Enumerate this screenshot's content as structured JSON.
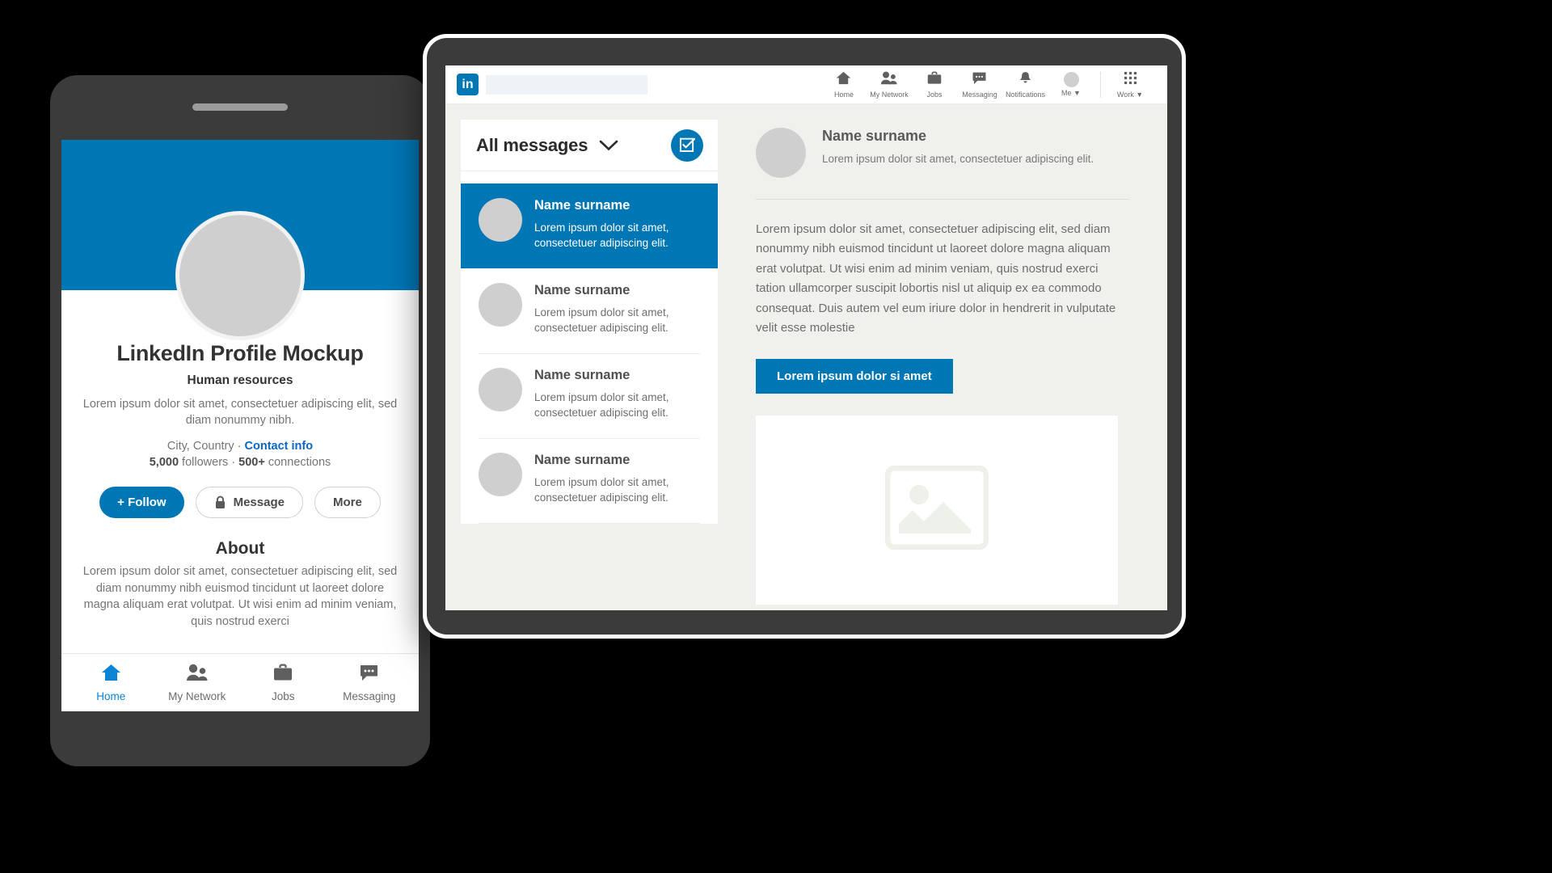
{
  "phone": {
    "profile": {
      "name": "LinkedIn Profile Mockup",
      "headline": "Human resources",
      "description": "Lorem ipsum dolor sit amet, consectetuer adipiscing elit, sed diam nonummy nibh.",
      "location": "City, Country · ",
      "contact_link": "Contact info",
      "followers_count": "5,000",
      "followers_label": " followers · ",
      "connections_count": "500+",
      "connections_label": " connections"
    },
    "buttons": {
      "follow": "+ Follow",
      "message": "Message",
      "more": "More"
    },
    "about": {
      "title": "About",
      "text": "Lorem ipsum dolor sit amet, consectetuer adipiscing elit, sed diam nonummy nibh euismod tincidunt ut laoreet dolore magna aliquam erat volutpat. Ut wisi enim ad minim veniam, quis nostrud exerci"
    },
    "nav": [
      {
        "label": "Home",
        "icon": "home-icon",
        "active": true
      },
      {
        "label": "My Network",
        "icon": "people-icon",
        "active": false
      },
      {
        "label": "Jobs",
        "icon": "briefcase-icon",
        "active": false
      },
      {
        "label": "Messaging",
        "icon": "message-bubble-icon",
        "active": false
      }
    ]
  },
  "tablet": {
    "logo": "in",
    "search_placeholder": "",
    "search_value": "",
    "nav": [
      {
        "label": "Home",
        "icon": "home-icon"
      },
      {
        "label": "My Network",
        "icon": "people-icon"
      },
      {
        "label": "Jobs",
        "icon": "briefcase-icon"
      },
      {
        "label": "Messaging",
        "icon": "message-bubble-icon"
      },
      {
        "label": "Notifications",
        "icon": "bell-icon"
      },
      {
        "label": "Me ▼",
        "icon": "avatar-icon"
      },
      {
        "label": "Work ▼",
        "icon": "grid-icon"
      }
    ],
    "messages": {
      "title": "All messages",
      "compose_label": "compose-icon",
      "items": [
        {
          "name": "Name surname",
          "snippet": "Lorem ipsum dolor sit amet, consectetuer adipiscing elit.",
          "selected": true
        },
        {
          "name": "Name surname",
          "snippet": "Lorem ipsum dolor sit amet, consectetuer adipiscing elit.",
          "selected": false
        },
        {
          "name": "Name surname",
          "snippet": "Lorem ipsum dolor sit amet, consectetuer adipiscing elit.",
          "selected": false
        },
        {
          "name": "Name surname",
          "snippet": "Lorem ipsum dolor sit amet, consectetuer adipiscing elit.",
          "selected": false
        }
      ]
    },
    "conversation": {
      "name": "Name surname",
      "subtitle": "Lorem ipsum dolor sit amet, consectetuer adipiscing elit.",
      "body": "Lorem ipsum dolor sit amet, consectetuer adipiscing elit, sed diam nonummy nibh euismod tincidunt ut laoreet dolore magna aliquam erat volutpat. Ut wisi enim ad minim veniam, quis nostrud exerci tation ullamcorper suscipit lobortis nisl ut aliquip ex ea commodo consequat. Duis autem vel eum iriure dolor in hendrerit in vulputate velit esse molestie",
      "cta": "Lorem ipsum dolor si amet",
      "image_placeholder": "image-placeholder-icon"
    }
  },
  "colors": {
    "linkedin_blue": "#0077b5",
    "link_blue": "#0a66c2",
    "device_body": "#3b3b3b",
    "placeholder_gray": "#cfcfcf",
    "background": "#000000"
  }
}
